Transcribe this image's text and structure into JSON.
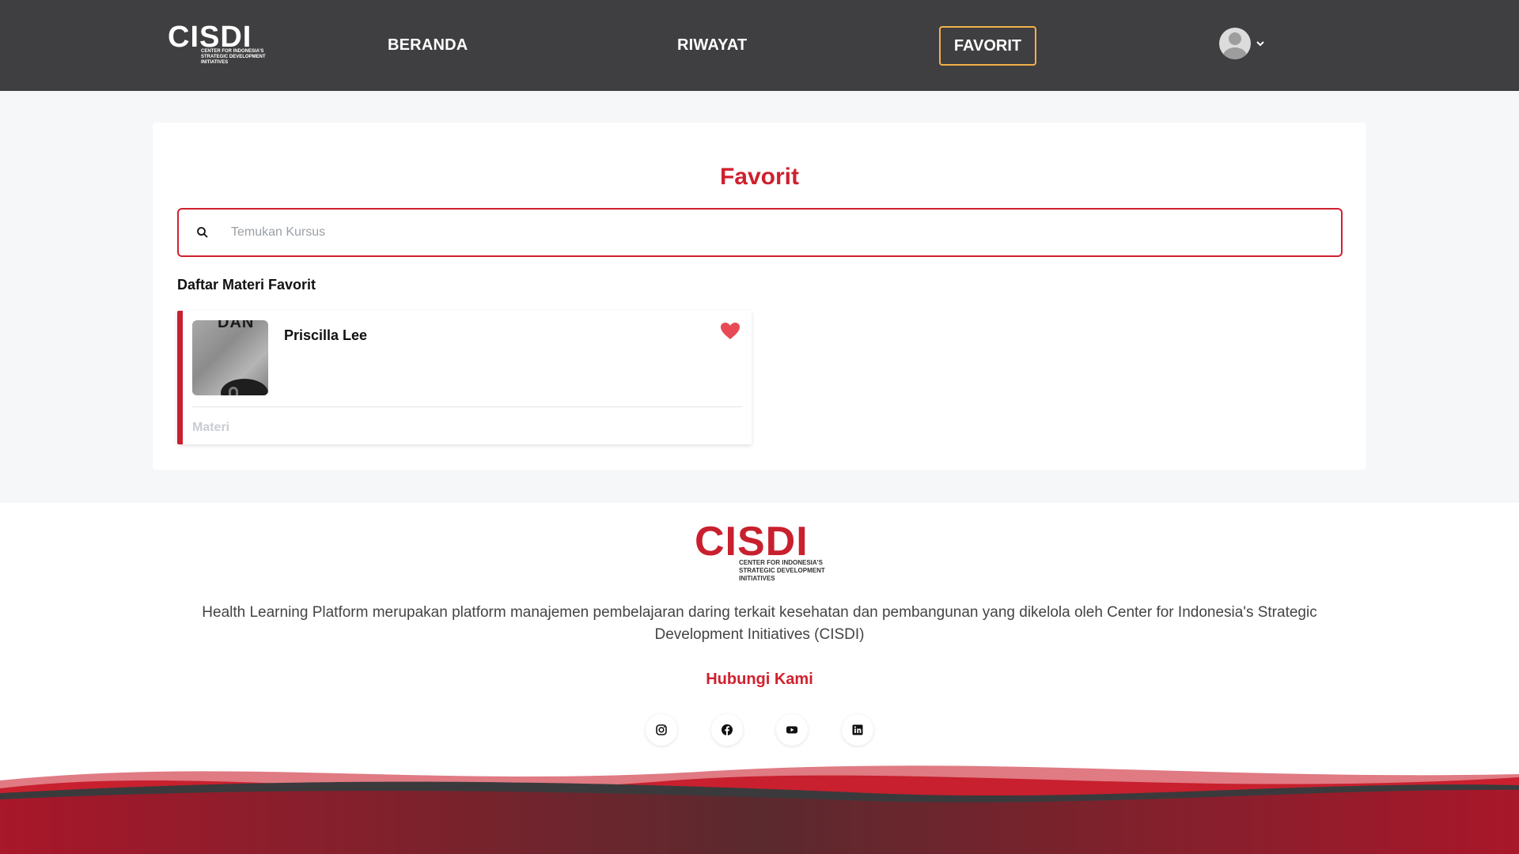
{
  "nav": {
    "logo_text": "CISDI",
    "logo_subtitle": "CENTER FOR INDONESIA'S STRATEGIC DEVELOPMENT INITIATIVES",
    "links": [
      {
        "label": "BERANDA"
      },
      {
        "label": "RIWAYAT"
      },
      {
        "label": "FAVORIT",
        "active": true
      }
    ],
    "avatar_icon": "user-avatar-icon",
    "menu_icon": "chevron-down-icon"
  },
  "main": {
    "title": "Favorit",
    "search": {
      "placeholder": "Temukan Kursus",
      "value": "",
      "icon": "search-icon"
    },
    "section_title": "Daftar Materi Favorit",
    "favorites": [
      {
        "name": "Priscilla Lee",
        "type": "Materi",
        "thumbnail_text": "DAN",
        "favorited": true,
        "icon": "heart-icon"
      }
    ]
  },
  "footer": {
    "logo_text": "CISDI",
    "logo_subtitle": "CENTER FOR INDONESIA'S STRATEGIC DEVELOPMENT INITIATIVES",
    "description": "Health Learning Platform merupakan platform manajemen pembelajaran daring terkait kesehatan dan pembangunan yang dikelola oleh Center for Indonesia's Strategic Development Initiatives (CISDI)",
    "contact_title": "Hubungi Kami",
    "socials": [
      "instagram-icon",
      "facebook-icon",
      "youtube-icon",
      "linkedin-icon"
    ]
  },
  "colors": {
    "nav_bg": "#3f3f41",
    "accent_red": "#d0202e",
    "active_border": "#f2b04a",
    "heart": "#e84a55"
  }
}
